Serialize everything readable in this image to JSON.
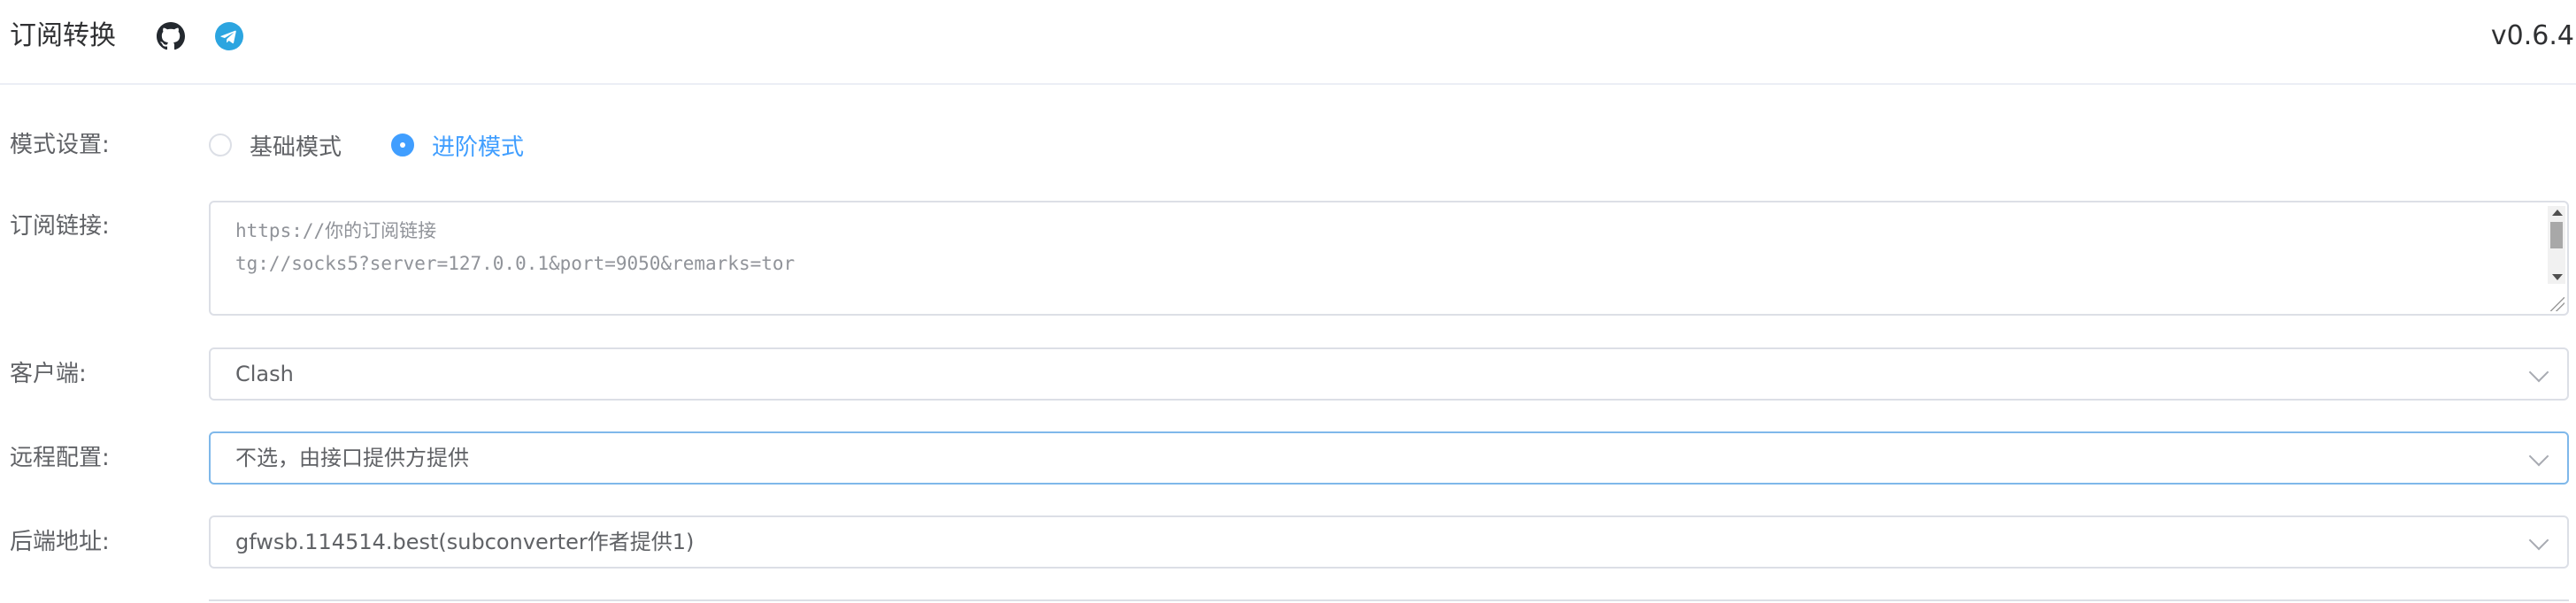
{
  "header": {
    "title": "订阅转换",
    "version": "v0.6.4",
    "icons": [
      "github-icon",
      "telegram-icon"
    ]
  },
  "form": {
    "mode": {
      "label": "模式设置:",
      "options": [
        "基础模式",
        "进阶模式"
      ],
      "selected": "进阶模式"
    },
    "subscription": {
      "label": "订阅链接:",
      "placeholder_lines": [
        "https://你的订阅链接",
        "tg://socks5?server=127.0.0.1&port=9050&remarks=tor"
      ]
    },
    "client": {
      "label": "客户端:",
      "value": "Clash"
    },
    "remote_config": {
      "label": "远程配置:",
      "value": "不选，由接口提供方提供"
    },
    "backend": {
      "label": "后端地址:",
      "value": "gfwsb.114514.best(subconverter作者提供1)"
    }
  },
  "colors": {
    "accent": "#409eff",
    "text": "#303133",
    "label": "#606266",
    "placeholder": "#909399",
    "border": "#dcdfe6",
    "focus_border": "#7fb8ea"
  }
}
